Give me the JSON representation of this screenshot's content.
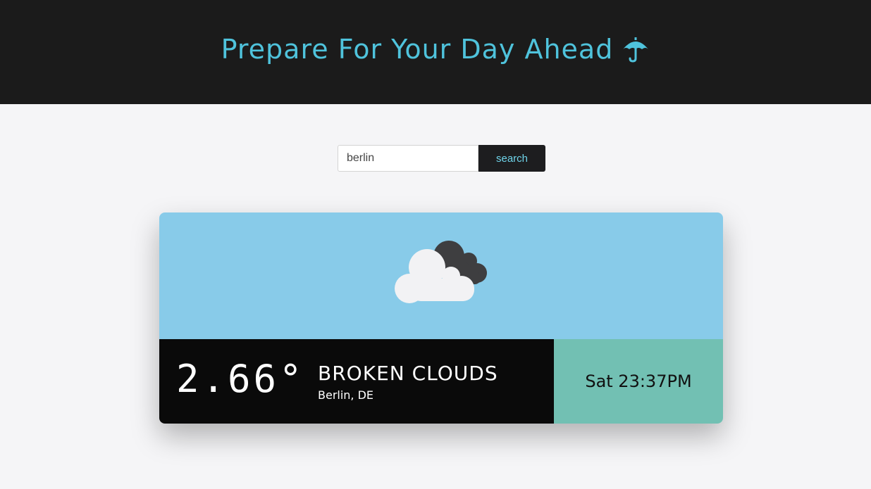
{
  "header": {
    "title": "Prepare For Your Day Ahead",
    "icon": "umbrella-icon",
    "title_color": "#4fc3dc",
    "background": "#1b1b1b"
  },
  "search": {
    "value": "berlin",
    "button_label": "search"
  },
  "weather": {
    "icon": "cloud-icon",
    "temperature": "2.66°",
    "condition": "BROKEN CLOUDS",
    "location": "Berlin, DE",
    "datetime": "Sat 23:37PM",
    "sky_color": "#88cbe9",
    "info_color": "#0a0a0a",
    "time_panel_color": "#72c0b3"
  }
}
